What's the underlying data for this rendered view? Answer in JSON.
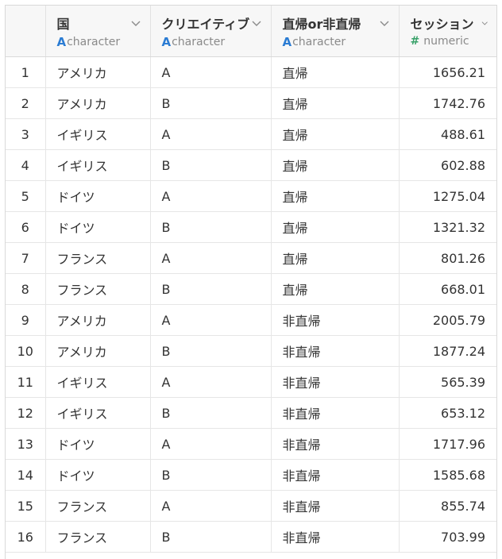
{
  "columns": [
    {
      "name": "国",
      "type": "character",
      "type_glyph": "A"
    },
    {
      "name": "クリエイティブ",
      "type": "character",
      "type_glyph": "A"
    },
    {
      "name": "直帰or非直帰",
      "type": "character",
      "type_glyph": "A"
    },
    {
      "name": "セッション",
      "type": "numeric",
      "type_glyph": "#"
    }
  ],
  "rows": [
    {
      "index": "1",
      "country": "アメリカ",
      "creative": "A",
      "bounce": "直帰",
      "sessions": "1656.21"
    },
    {
      "index": "2",
      "country": "アメリカ",
      "creative": "B",
      "bounce": "直帰",
      "sessions": "1742.76"
    },
    {
      "index": "3",
      "country": "イギリス",
      "creative": "A",
      "bounce": "直帰",
      "sessions": "488.61"
    },
    {
      "index": "4",
      "country": "イギリス",
      "creative": "B",
      "bounce": "直帰",
      "sessions": "602.88"
    },
    {
      "index": "5",
      "country": "ドイツ",
      "creative": "A",
      "bounce": "直帰",
      "sessions": "1275.04"
    },
    {
      "index": "6",
      "country": "ドイツ",
      "creative": "B",
      "bounce": "直帰",
      "sessions": "1321.32"
    },
    {
      "index": "7",
      "country": "フランス",
      "creative": "A",
      "bounce": "直帰",
      "sessions": "801.26"
    },
    {
      "index": "8",
      "country": "フランス",
      "creative": "B",
      "bounce": "直帰",
      "sessions": "668.01"
    },
    {
      "index": "9",
      "country": "アメリカ",
      "creative": "A",
      "bounce": "非直帰",
      "sessions": "2005.79"
    },
    {
      "index": "10",
      "country": "アメリカ",
      "creative": "B",
      "bounce": "非直帰",
      "sessions": "1877.24"
    },
    {
      "index": "11",
      "country": "イギリス",
      "creative": "A",
      "bounce": "非直帰",
      "sessions": "565.39"
    },
    {
      "index": "12",
      "country": "イギリス",
      "creative": "B",
      "bounce": "非直帰",
      "sessions": "653.12"
    },
    {
      "index": "13",
      "country": "ドイツ",
      "creative": "A",
      "bounce": "非直帰",
      "sessions": "1717.96"
    },
    {
      "index": "14",
      "country": "ドイツ",
      "creative": "B",
      "bounce": "非直帰",
      "sessions": "1585.68"
    },
    {
      "index": "15",
      "country": "フランス",
      "creative": "A",
      "bounce": "非直帰",
      "sessions": "855.74"
    },
    {
      "index": "16",
      "country": "フランス",
      "creative": "B",
      "bounce": "非直帰",
      "sessions": "703.99"
    }
  ],
  "colors": {
    "character_type": "#2b7cd3",
    "numeric_type": "#38a169",
    "header_bg": "#f7f7f7",
    "grid_line": "#e6e6e6"
  },
  "icons": {
    "sort_menu": "chevron-down-icon",
    "character_type": "character-type-icon",
    "numeric_type": "numeric-type-icon"
  }
}
